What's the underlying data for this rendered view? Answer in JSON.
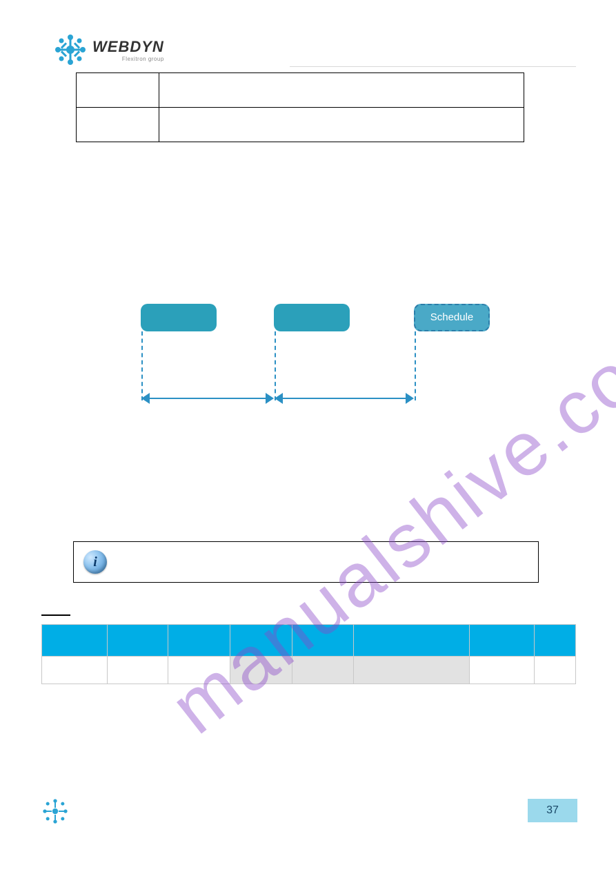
{
  "header": {
    "brand": "WEBDYN",
    "sub_brand": "Flexitron group"
  },
  "diagram": {
    "box_c_label": "Schedule"
  },
  "info_box": {
    "icon_glyph": "i"
  },
  "footer": {
    "page_number": "37"
  },
  "watermark": {
    "text": "manualshive.com"
  },
  "colors": {
    "accent_teal": "#2ba0ba",
    "accent_dash": "#2b90c4",
    "table_header": "#00aee6",
    "footer_badge": "#9bd9ec"
  }
}
